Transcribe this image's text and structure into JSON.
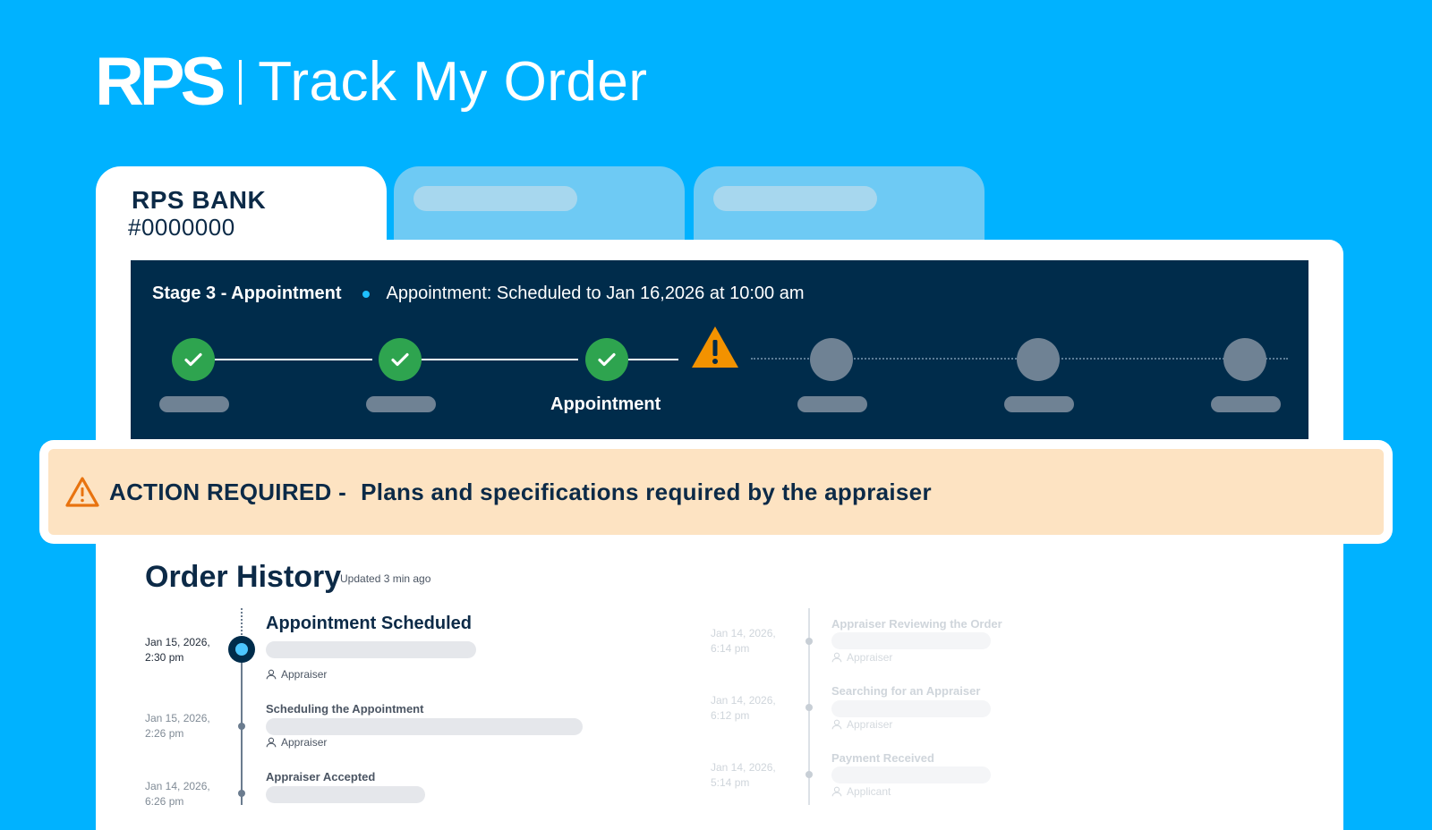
{
  "header": {
    "logo": "RPS",
    "title": "Track My Order"
  },
  "tabs": [
    {
      "bank": "RPS BANK",
      "order": "#0000000",
      "active": true
    },
    {
      "placeholder": true
    },
    {
      "placeholder": true
    }
  ],
  "stage": {
    "title": "Stage 3 - Appointment",
    "status": "Appointment: Scheduled to Jan 16,2026 at 10:00 am",
    "current_label": "Appointment",
    "steps": [
      "done",
      "done",
      "done",
      "warning",
      "future",
      "future",
      "future"
    ]
  },
  "alert": {
    "heading": "ACTION REQUIRED -",
    "message": "Plans and specifications required by the appraiser"
  },
  "history": {
    "title": "Order History",
    "updated": "Updated 3 min ago",
    "events_left": [
      {
        "date1": "Jan 15, 2026,",
        "date2": "2:30 pm",
        "title": "Appointment Scheduled",
        "role": "Appraiser"
      },
      {
        "date1": "Jan 15, 2026,",
        "date2": "2:26 pm",
        "title": "Scheduling the Appointment",
        "role": "Appraiser"
      },
      {
        "date1": "Jan 14, 2026,",
        "date2": "6:26 pm",
        "title": "Appraiser Accepted",
        "role": ""
      }
    ],
    "events_right": [
      {
        "date1": "Jan 14, 2026,",
        "date2": "6:14 pm",
        "title": "Appraiser Reviewing the Order",
        "role": "Appraiser"
      },
      {
        "date1": "Jan 14, 2026,",
        "date2": "6:12 pm",
        "title": "Searching for an Appraiser",
        "role": "Appraiser"
      },
      {
        "date1": "Jan 14, 2026,",
        "date2": "5:14 pm",
        "title": "Payment Received",
        "role": "Applicant"
      }
    ]
  },
  "colors": {
    "background": "#00b2ff",
    "navy": "#002c4b",
    "success": "#2ea44f",
    "warning": "#f39200",
    "alert_bg": "#fde3c2"
  },
  "icons": [
    "check-icon",
    "warning-triangle-icon",
    "user-icon"
  ]
}
